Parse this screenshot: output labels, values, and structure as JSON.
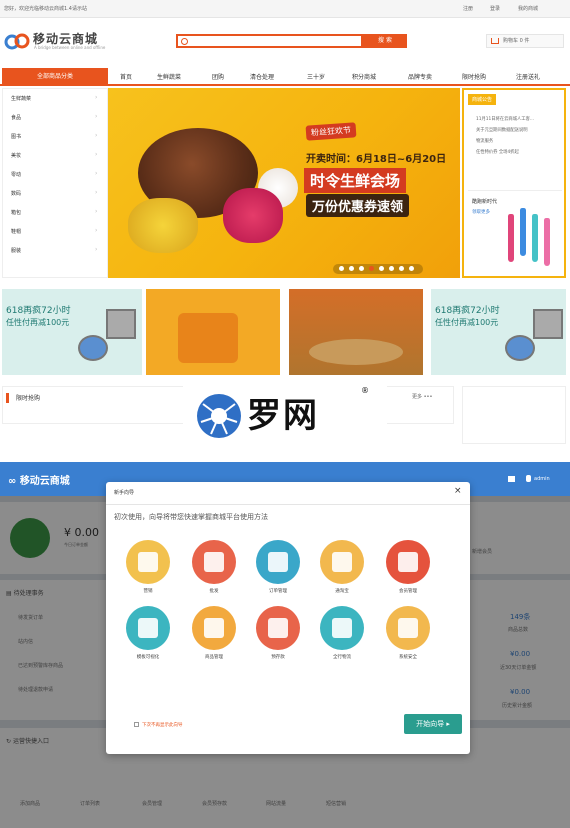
{
  "top": {
    "welcome": "您好，欢迎光临移动云商城1.4请示站",
    "links": [
      "注册",
      "登录",
      "我的商城"
    ],
    "logo_title": "移动云商城",
    "logo_sub": "A bridge between online and offline",
    "search_button": "搜 索",
    "cart_label": "购物车 0 件",
    "all_categories": "全部商品分类",
    "nav": [
      "首页",
      "生鲜蔬菜",
      "团购",
      "清仓处理",
      "三十岁",
      "积分商城",
      "品牌专卖",
      "限时抢购",
      "注册送礼"
    ],
    "sidebar": [
      "生鲜蔬菜",
      "食品",
      "图书",
      "美妆",
      "零动",
      "数码",
      "箱包",
      "鞋帽",
      "服装"
    ],
    "banner": {
      "tag": "粉丝狂欢节",
      "time": "开卖时间：6月18日~6月20日",
      "title": "时令生鲜会场",
      "subtitle": "万份优惠券速领"
    },
    "notice": {
      "head": "商城公告",
      "lines": [
        "11月11日将在云商城人工客...",
        "关于元旦期间数据配送说明",
        "物流服务",
        "任性特价券 全场4折起"
      ],
      "brand": "酷跑新时代",
      "brand_link": "领取更多"
    },
    "promo_text_1": "618再疯72小时",
    "promo_text_2": "任性付再减100元",
    "flash_title": "限时抢购",
    "more": "更多"
  },
  "watermark": {
    "text": "罗网",
    "reg": "®"
  },
  "admin": {
    "logo": "移动云商城",
    "user": "admin",
    "balance": "¥ 0.00",
    "balance_label": "今日订单金额",
    "pending_title": "待处理事务",
    "pending_items": [
      "待发货订单",
      "站内信",
      "已达到预警库存商品",
      "待处理退款申请"
    ],
    "member_label": "新增会员",
    "goods_count": "149条",
    "goods_count_label": "商品总数",
    "stat_2": "¥0.00",
    "stat_2_label": "近30天订单金额",
    "stat_3": "¥0.00",
    "stat_3_label": "历史累计金额",
    "quick_title": "运营快捷入口",
    "quick_items": [
      "添加商品",
      "订单列表",
      "会员管理",
      "会员预存款",
      "网站流量",
      "短信营销"
    ]
  },
  "dialog": {
    "title": "新手向导",
    "close": "×",
    "intro": "初次使用，向导将带您快速掌握商城平台使用方法",
    "items": [
      {
        "label": "营销",
        "color": "#f2c14e"
      },
      {
        "label": "批发",
        "color": "#e8644a"
      },
      {
        "label": "订单管理",
        "color": "#3aa7c9"
      },
      {
        "label": "通淘宝",
        "color": "#f2b84e"
      },
      {
        "label": "会员管理",
        "color": "#e5533d"
      },
      {
        "label": "模板可视化",
        "color": "#3cb5c0"
      },
      {
        "label": "商品管理",
        "color": "#f2a93e"
      },
      {
        "label": "预存款",
        "color": "#e8644a"
      },
      {
        "label": "全行物流",
        "color": "#3cb5c0"
      },
      {
        "label": "系统安全",
        "color": "#f2b84e"
      }
    ],
    "no_show": "下次不再显示此向导",
    "start": "开始向导"
  }
}
